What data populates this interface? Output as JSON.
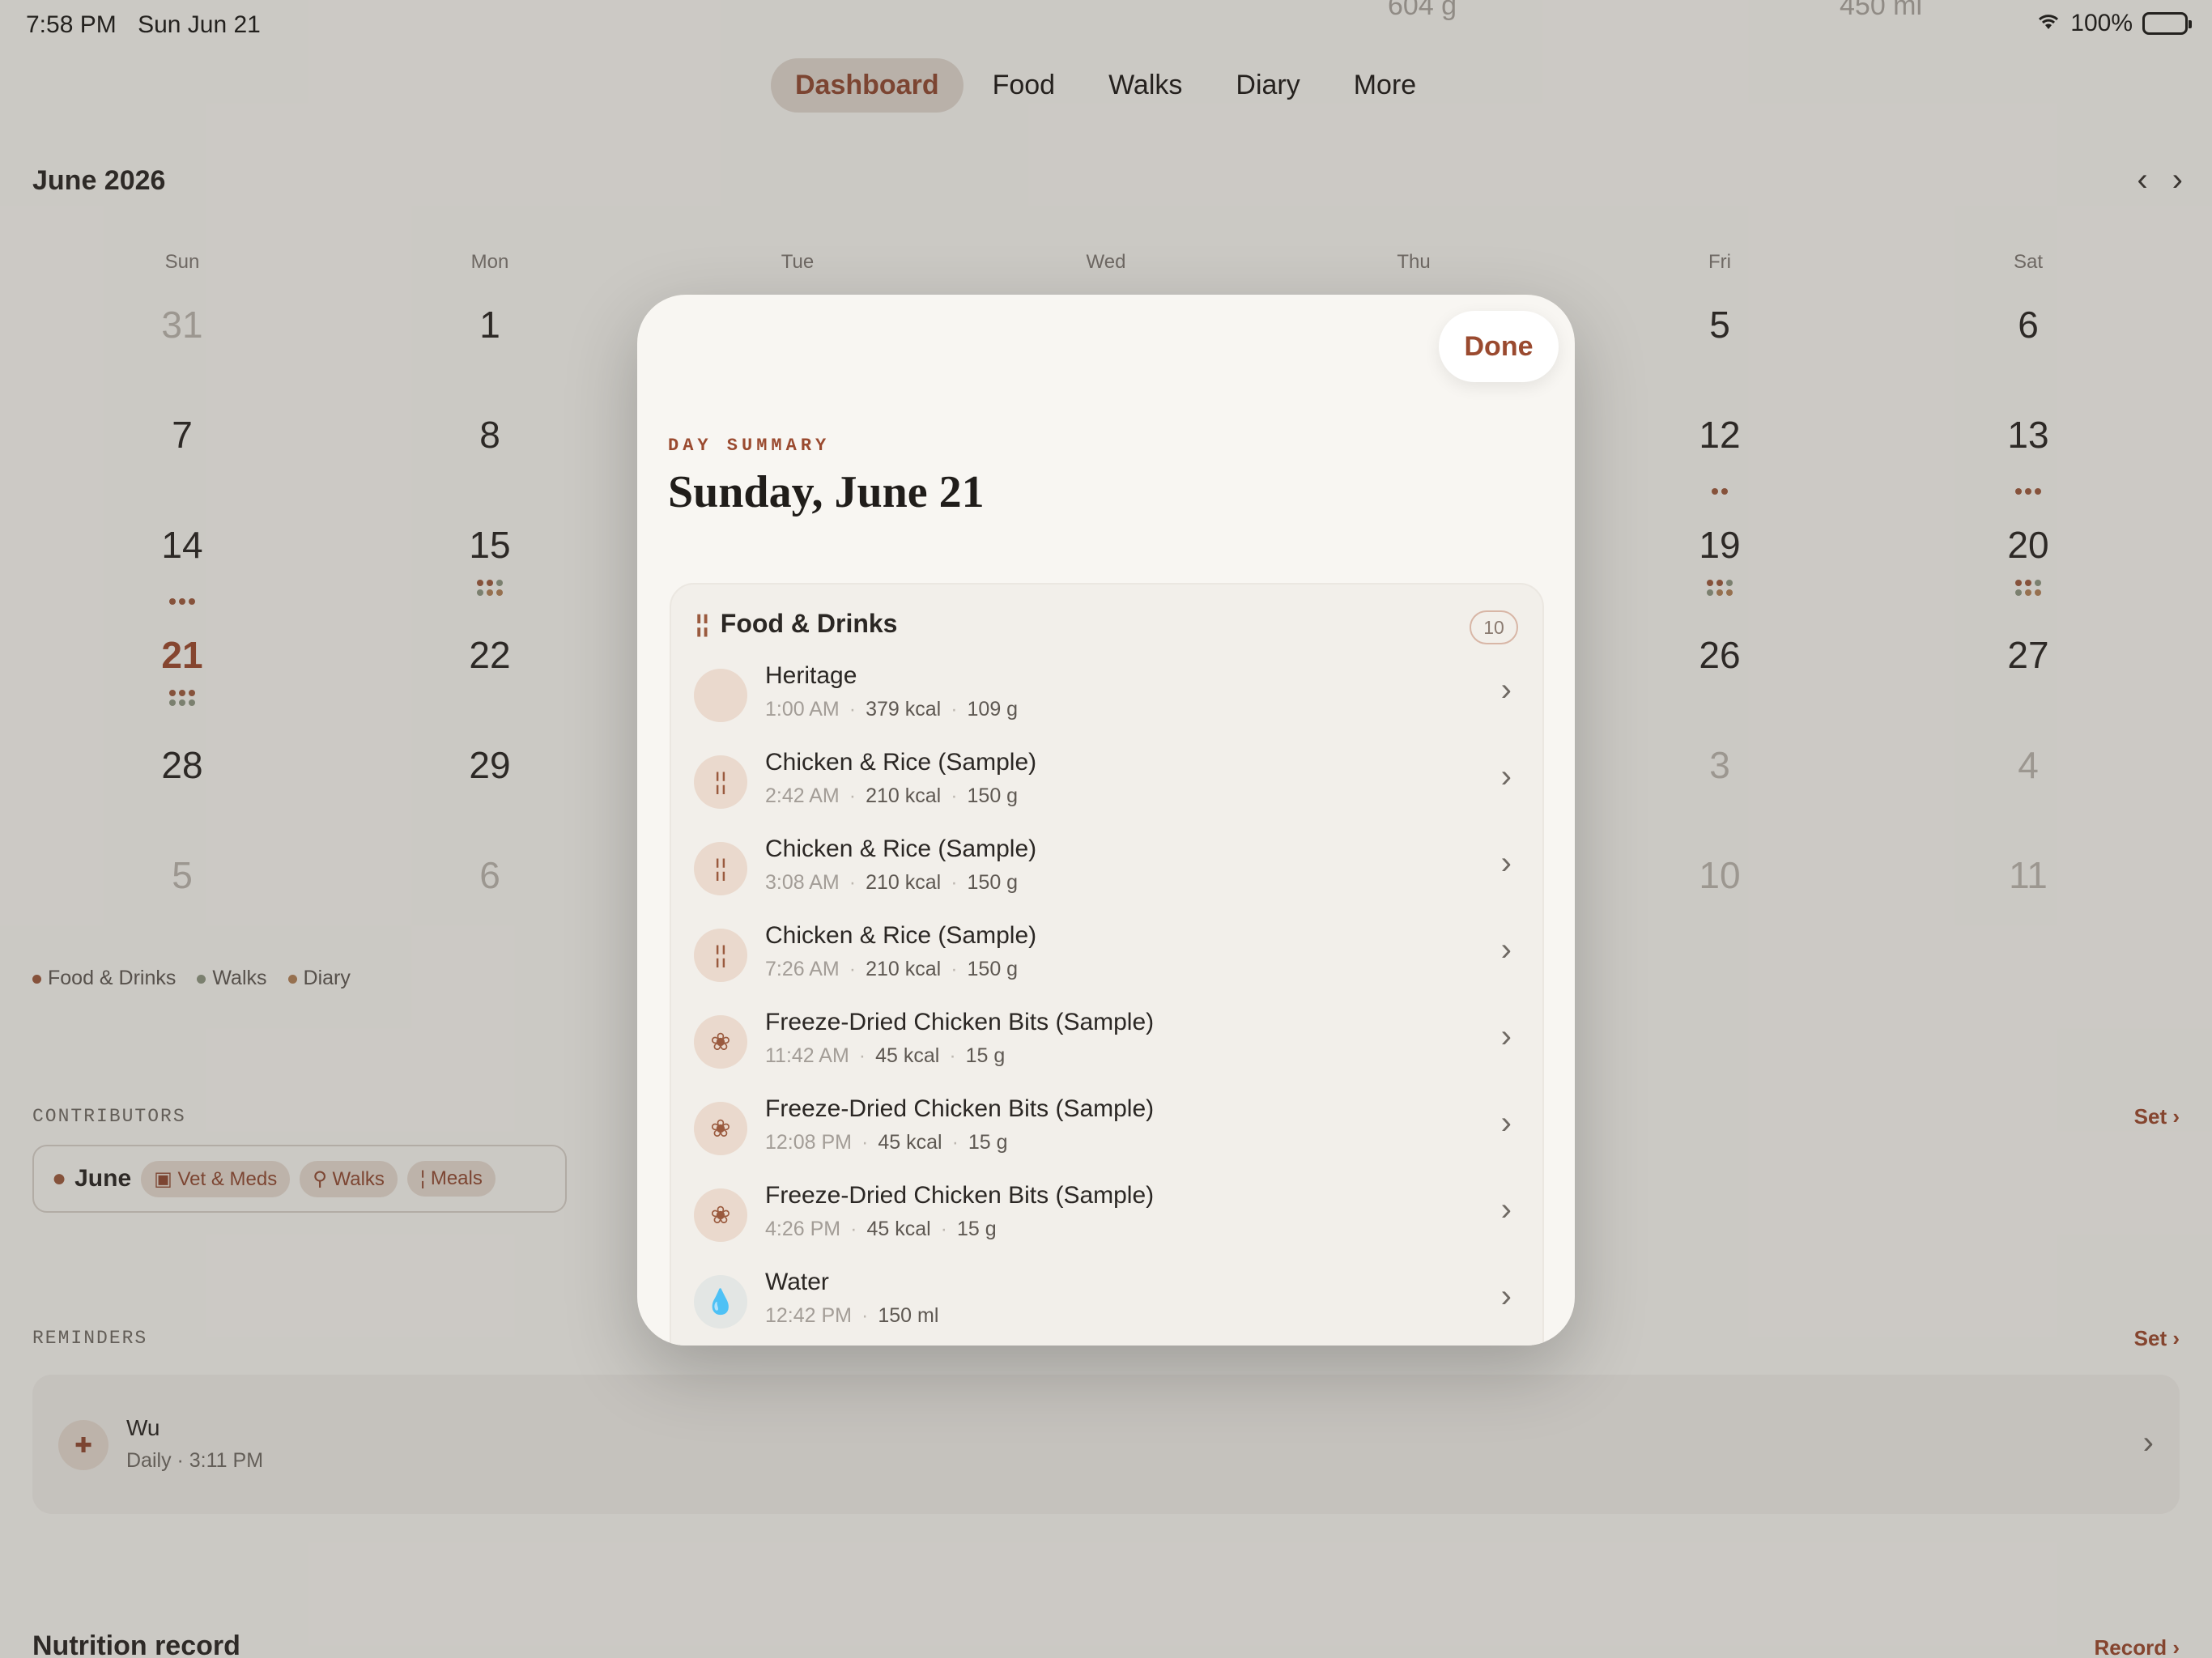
{
  "status": {
    "time": "7:58 PM",
    "date": "Sun Jun 21",
    "battery": "100%"
  },
  "background_top": {
    "a": "604 g",
    "b": "450 ml"
  },
  "tabs": [
    {
      "label": "Dashboard",
      "active": true
    },
    {
      "label": "Food"
    },
    {
      "label": "Walks"
    },
    {
      "label": "Diary"
    },
    {
      "label": "More"
    }
  ],
  "calendar": {
    "month": "June 2026",
    "weekdays": [
      "Sun",
      "Mon",
      "Tue",
      "Wed",
      "Thu",
      "Fri",
      "Sat"
    ],
    "days": {
      "r0": [
        "31",
        "1",
        "5",
        "6"
      ],
      "r1": [
        "7",
        "8",
        "12",
        "13"
      ],
      "r2": [
        "14",
        "15",
        "19",
        "20"
      ],
      "r3": [
        "21",
        "22",
        "26",
        "27"
      ],
      "r4": [
        "28",
        "29",
        "3",
        "4"
      ],
      "r5": [
        "5",
        "6",
        "10",
        "11"
      ]
    }
  },
  "legend": [
    "Food & Drinks",
    "Walks",
    "Diary"
  ],
  "contributors": {
    "label": "CONTRIBUTORS",
    "set": "Set",
    "name": "June",
    "chips": [
      "Vet & Meds",
      "Walks",
      "Meals"
    ]
  },
  "reminders": {
    "label": "REMINDERS",
    "set": "Set",
    "title": "Wu",
    "subtitle": "Daily · 3:11 PM"
  },
  "nutrition": {
    "title": "Nutrition record",
    "record": "Record"
  },
  "modal": {
    "done": "Done",
    "eyebrow": "DAY SUMMARY",
    "title": "Sunday, June 21",
    "section": "Food & Drinks",
    "count": "10",
    "rows": [
      {
        "name": "Heritage",
        "time": "1:00 AM",
        "a": "379 kcal",
        "b": "109 g",
        "icon": "blank"
      },
      {
        "name": "Chicken & Rice (Sample)",
        "time": "2:42 AM",
        "a": "210 kcal",
        "b": "150 g",
        "icon": "fork-knife"
      },
      {
        "name": "Chicken & Rice (Sample)",
        "time": "3:08 AM",
        "a": "210 kcal",
        "b": "150 g",
        "icon": "fork-knife"
      },
      {
        "name": "Chicken & Rice (Sample)",
        "time": "7:26 AM",
        "a": "210 kcal",
        "b": "150 g",
        "icon": "fork-knife"
      },
      {
        "name": "Freeze-Dried Chicken Bits (Sample)",
        "time": "11:42 AM",
        "a": "45 kcal",
        "b": "15 g",
        "icon": "paw"
      },
      {
        "name": "Freeze-Dried Chicken Bits (Sample)",
        "time": "12:08 PM",
        "a": "45 kcal",
        "b": "15 g",
        "icon": "paw"
      },
      {
        "name": "Freeze-Dried Chicken Bits (Sample)",
        "time": "4:26 PM",
        "a": "45 kcal",
        "b": "15 g",
        "icon": "paw"
      },
      {
        "name": "Water",
        "time": "12:42 PM",
        "a": "150 ml",
        "b": "",
        "icon": "droplet"
      }
    ]
  },
  "colors": {
    "accent": "#9a4a2f",
    "food": "#9b5a3e",
    "walks": "#8e9580",
    "diary": "#b08058"
  }
}
